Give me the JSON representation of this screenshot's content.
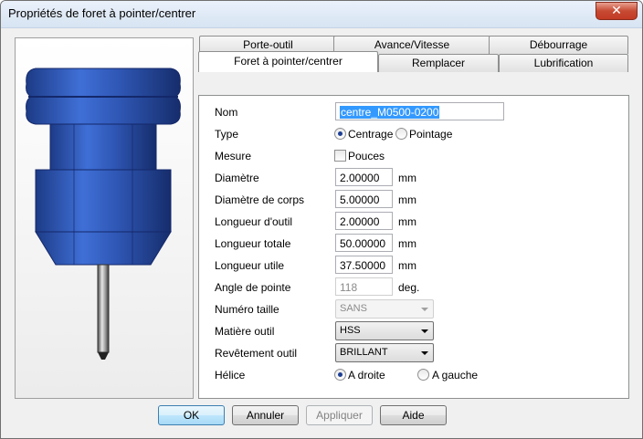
{
  "window": {
    "title": "Propriétés de foret à pointer/centrer",
    "close_glyph": "✕"
  },
  "tabs": {
    "row1": [
      "Porte-outil",
      "Avance/Vitesse",
      "Débourrage"
    ],
    "row2": [
      "Foret à pointer/centrer",
      "Remplacer",
      "Lubrification"
    ],
    "active": "Foret à pointer/centrer"
  },
  "form": {
    "name_label": "Nom",
    "name_value": "centre_M0500-0200",
    "type_label": "Type",
    "type_opt1": "Centrage",
    "type_opt2": "Pointage",
    "type_selected": "Centrage",
    "measure_label": "Mesure",
    "measure_opt": "Pouces",
    "diam_label": "Diamètre",
    "diam_value": "2.00000",
    "diam_unit": "mm",
    "body_label": "Diamètre de corps",
    "body_value": "5.00000",
    "body_unit": "mm",
    "tlen_label": "Longueur d'outil",
    "tlen_value": "2.00000",
    "tlen_unit": "mm",
    "total_label": "Longueur totale",
    "total_value": "50.00000",
    "total_unit": "mm",
    "useful_label": "Longueur utile",
    "useful_value": "37.50000",
    "useful_unit": "mm",
    "angle_label": "Angle de pointe",
    "angle_value": "118",
    "angle_unit": "deg.",
    "size_label": "Numéro taille",
    "size_value": "SANS",
    "mat_label": "Matière outil",
    "mat_value": "HSS",
    "coat_label": "Revêtement outil",
    "coat_value": "BRILLANT",
    "helix_label": "Hélice",
    "helix_opt1": "A droite",
    "helix_opt2": "A gauche",
    "helix_selected": "A droite"
  },
  "buttons": {
    "ok": "OK",
    "cancel": "Annuler",
    "apply": "Appliquer",
    "help": "Aide"
  },
  "colors": {
    "tool_body": "#2f57b5",
    "tool_dark": "#1b3578",
    "selection": "#3399ff"
  }
}
